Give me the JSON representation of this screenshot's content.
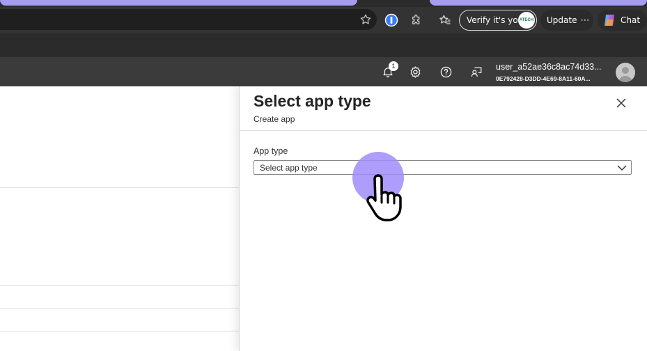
{
  "browser": {
    "verify_label": "Verify it's you",
    "verify_avatar_text": "ATECH",
    "update_label": "Update",
    "update_more": "⋯",
    "chat_label": "Chat"
  },
  "portal_header": {
    "notification_count": "1",
    "user_name": "user_a52ae36c8ac74d33...",
    "user_tenant": "0E792428-D3DD-4E69-8A11-60A..."
  },
  "panel": {
    "title": "Select app type",
    "subtitle": "Create app",
    "field_label": "App type",
    "select_placeholder": "Select app type"
  },
  "colors": {
    "tab_accent": "#a59ef0",
    "click_indicator": "#a08cfa"
  }
}
